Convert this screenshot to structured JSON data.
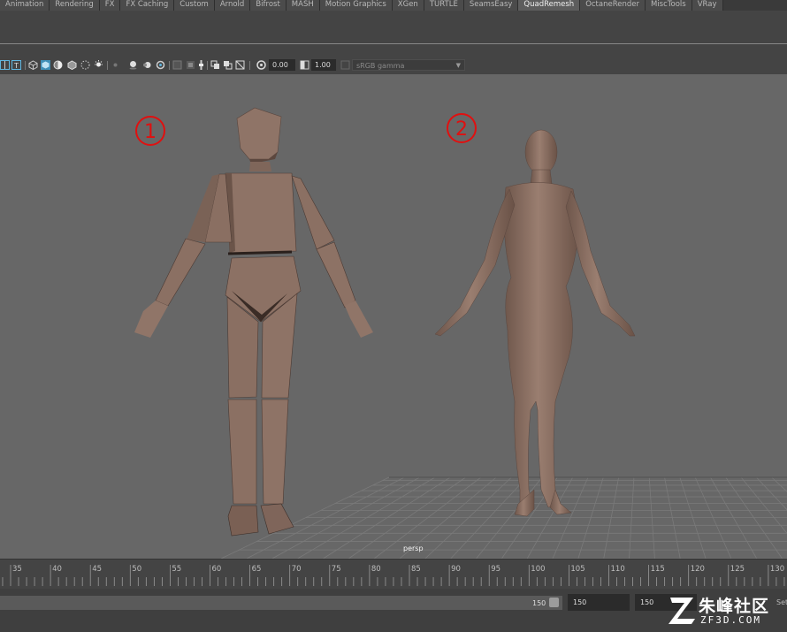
{
  "shelf": {
    "tabs": [
      {
        "label": "Animation",
        "active": false
      },
      {
        "label": "Rendering",
        "active": false
      },
      {
        "label": "FX",
        "active": false
      },
      {
        "label": "FX Caching",
        "active": false
      },
      {
        "label": "Custom",
        "active": false
      },
      {
        "label": "Arnold",
        "active": false
      },
      {
        "label": "Bifrost",
        "active": false
      },
      {
        "label": "MASH",
        "active": false
      },
      {
        "label": "Motion Graphics",
        "active": false
      },
      {
        "label": "XGen",
        "active": false
      },
      {
        "label": "TURTLE",
        "active": false
      },
      {
        "label": "SeamsEasy",
        "active": false
      },
      {
        "label": "QuadRemesh",
        "active": true
      },
      {
        "label": "OctaneRender",
        "active": false
      },
      {
        "label": "MiscTools",
        "active": false
      },
      {
        "label": "VRay",
        "active": false
      }
    ]
  },
  "panel_toolbar": {
    "exposure_value": "0.00",
    "gamma_value": "1.00",
    "color_space": "sRGB gamma"
  },
  "viewport": {
    "camera_label": "persp",
    "model_labels": [
      "①",
      "②"
    ],
    "label_color": "#e01010",
    "background_color": "#676767",
    "model_color": "#8d7264"
  },
  "time_slider": {
    "ticks": [
      "35",
      "40",
      "45",
      "50",
      "55",
      "60",
      "65",
      "70",
      "75",
      "80",
      "85",
      "90",
      "95",
      "100",
      "105",
      "110",
      "115",
      "120",
      "125",
      "130",
      "135"
    ]
  },
  "range_slider": {
    "range_end": "150",
    "anim_end": "150",
    "playback_end": "150",
    "set_label": "Set"
  },
  "watermark": {
    "cn_text": "朱峰社区",
    "en_text": "ZF3D.COM"
  }
}
